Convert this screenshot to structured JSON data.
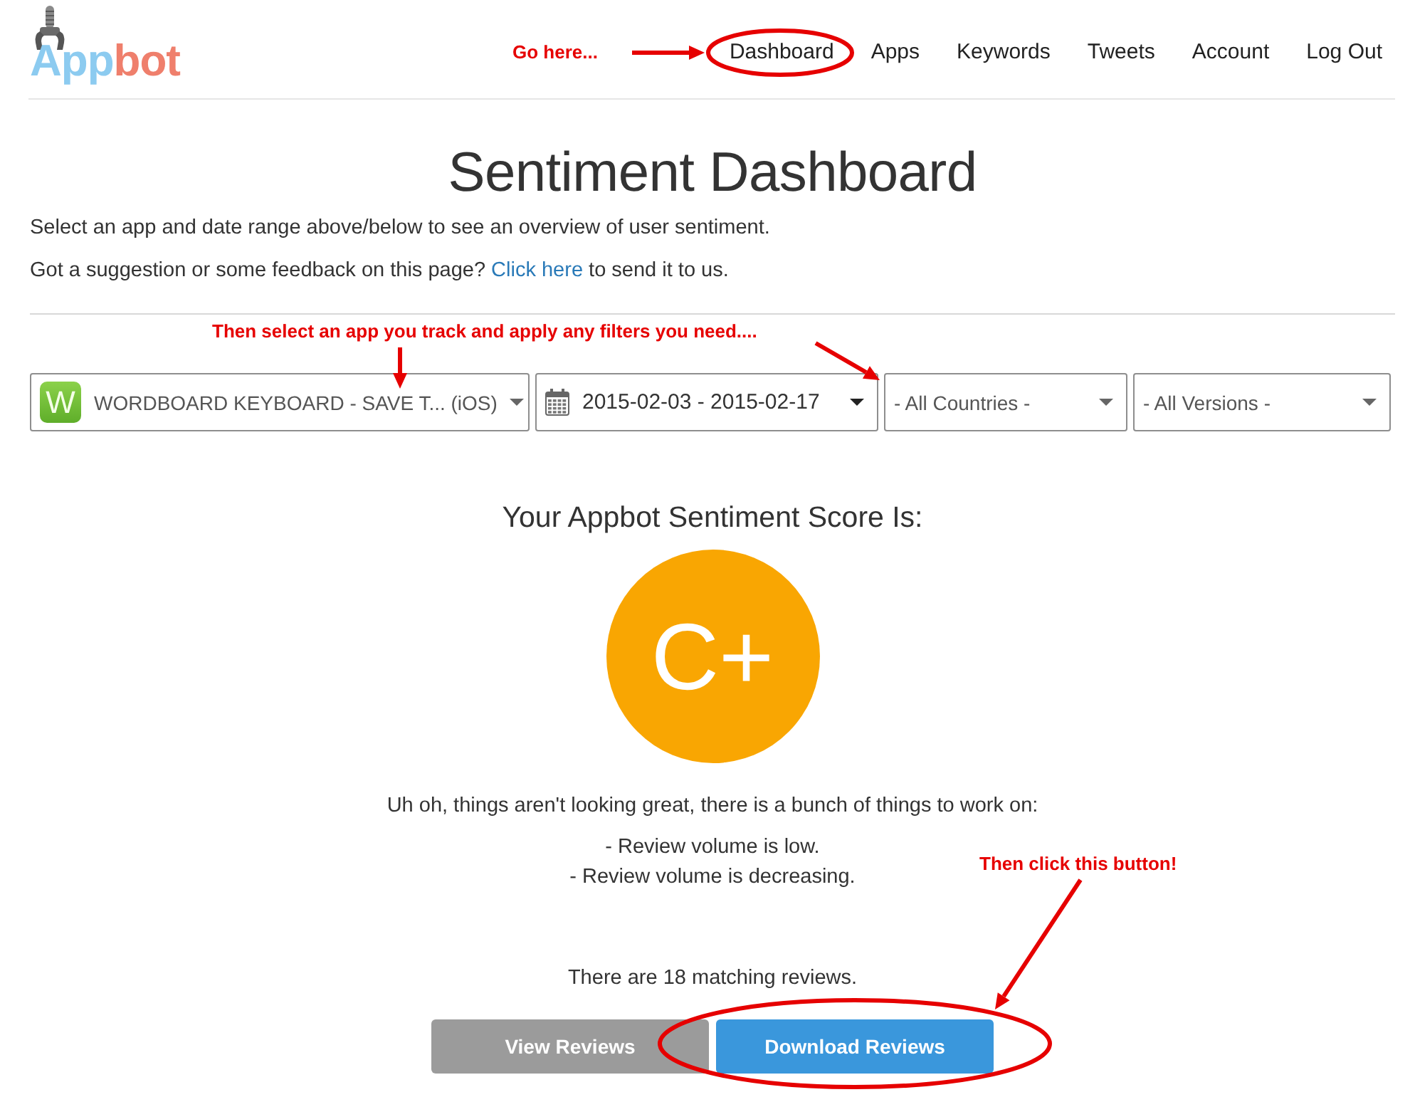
{
  "header": {
    "logo": {
      "parts": [
        "App",
        "bot"
      ]
    },
    "nav": [
      {
        "label": "Dashboard"
      },
      {
        "label": "Apps"
      },
      {
        "label": "Keywords"
      },
      {
        "label": "Tweets"
      },
      {
        "label": "Account"
      },
      {
        "label": "Log Out"
      }
    ]
  },
  "page": {
    "title": "Sentiment Dashboard",
    "intro": "Select an app and date range above/below to see an overview of user sentiment.",
    "feedback": {
      "before": "Got a suggestion or some feedback on this page?",
      "link": "Click here",
      "after": "to send it to us."
    }
  },
  "filters": [
    {
      "kind": "app",
      "icon_letter": "W",
      "value": "WORDBOARD KEYBOARD - SAVE T... (iOS)"
    },
    {
      "kind": "date",
      "value": "2015-02-03 - 2015-02-17"
    },
    {
      "kind": "select",
      "value": "- All Countries -"
    },
    {
      "kind": "select",
      "value": "- All Versions -"
    }
  ],
  "score": {
    "heading": "Your Appbot Sentiment Score Is:",
    "grade": "C+",
    "message": "Uh oh, things aren't looking great, there is a bunch of things to work on:",
    "issues": [
      "- Review volume is low.",
      "- Review volume is decreasing."
    ],
    "match_count": "There are 18 matching reviews."
  },
  "buttons": [
    {
      "kind": "secondary",
      "label": "View Reviews"
    },
    {
      "kind": "primary",
      "label": "Download Reviews"
    }
  ],
  "annotations": {
    "nav_note": "Go here...",
    "filter_note": "Then select an app you track and apply any filters you need....",
    "button_note": "Then click this button!"
  }
}
